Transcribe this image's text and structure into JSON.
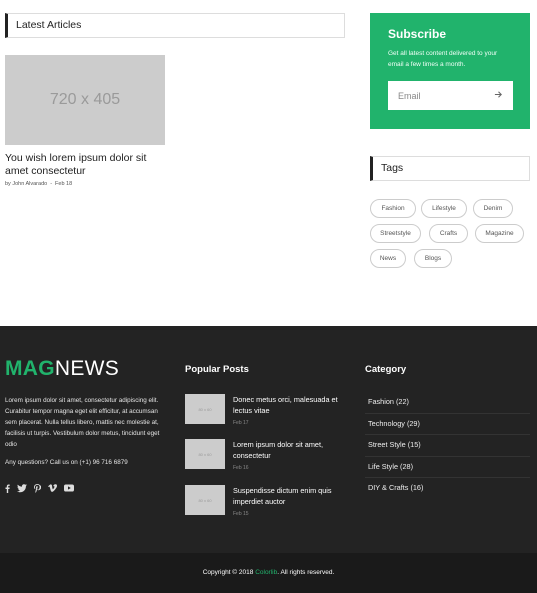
{
  "latest": {
    "heading": "Latest Articles",
    "post": {
      "image_label": "720 x 405",
      "title": "You wish lorem ipsum dolor sit amet consectetur",
      "author": "by John Alvarado",
      "separator": "-",
      "date": "Feb 18"
    }
  },
  "subscribe": {
    "title": "Subscribe",
    "text": "Get all latest content delivered to your email a few times a month.",
    "email_placeholder": "Email",
    "submit_icon": "arrow-right-icon"
  },
  "tags": {
    "heading": "Tags",
    "items": [
      "Fashion",
      "Lifestyle",
      "Denim",
      "Streetstyle",
      "Crafts",
      "Magazine",
      "News",
      "Blogs"
    ]
  },
  "footer": {
    "logo_mag": "MAG",
    "logo_news": "NEWS",
    "about": "Lorem ipsum dolor sit amet, consectetur adipiscing elit. Curabitur tempor magna eget elit efficitur, at accumsan sem placerat. Nulla tellus libero, mattis nec molestie at, facilisis ut turpis. Vestibulum dolor metus, tincidunt eget odio",
    "contact": "Any questions? Call us on (+1) 96 716 6879",
    "social_icons": [
      "facebook-icon",
      "twitter-icon",
      "pinterest-icon",
      "vimeo-icon",
      "youtube-icon"
    ],
    "popular_title": "Popular Posts",
    "popular_posts": [
      {
        "thumb": "80 x 60",
        "title": "Donec metus orci, malesuada et lectus vitae",
        "date": "Feb 17"
      },
      {
        "thumb": "80 x 60",
        "title": "Lorem ipsum dolor sit amet, consectetur",
        "date": "Feb 16"
      },
      {
        "thumb": "80 x 60",
        "title": "Suspendisse dictum enim quis imperdiet auctor",
        "date": "Feb 15"
      }
    ],
    "category_title": "Category",
    "categories": [
      "Fashion (22)",
      "Technology (29)",
      "Street Style (15)",
      "Life Style (28)",
      "DIY & Crafts (16)"
    ],
    "copyright_pre": "Copyright © 2018 ",
    "copyright_brand": "Colorlib",
    "copyright_post": ". All rights reserved."
  },
  "colors": {
    "accent": "#21b36c",
    "footer_bg": "#232323",
    "bottom_bg": "#1a1a1a"
  }
}
